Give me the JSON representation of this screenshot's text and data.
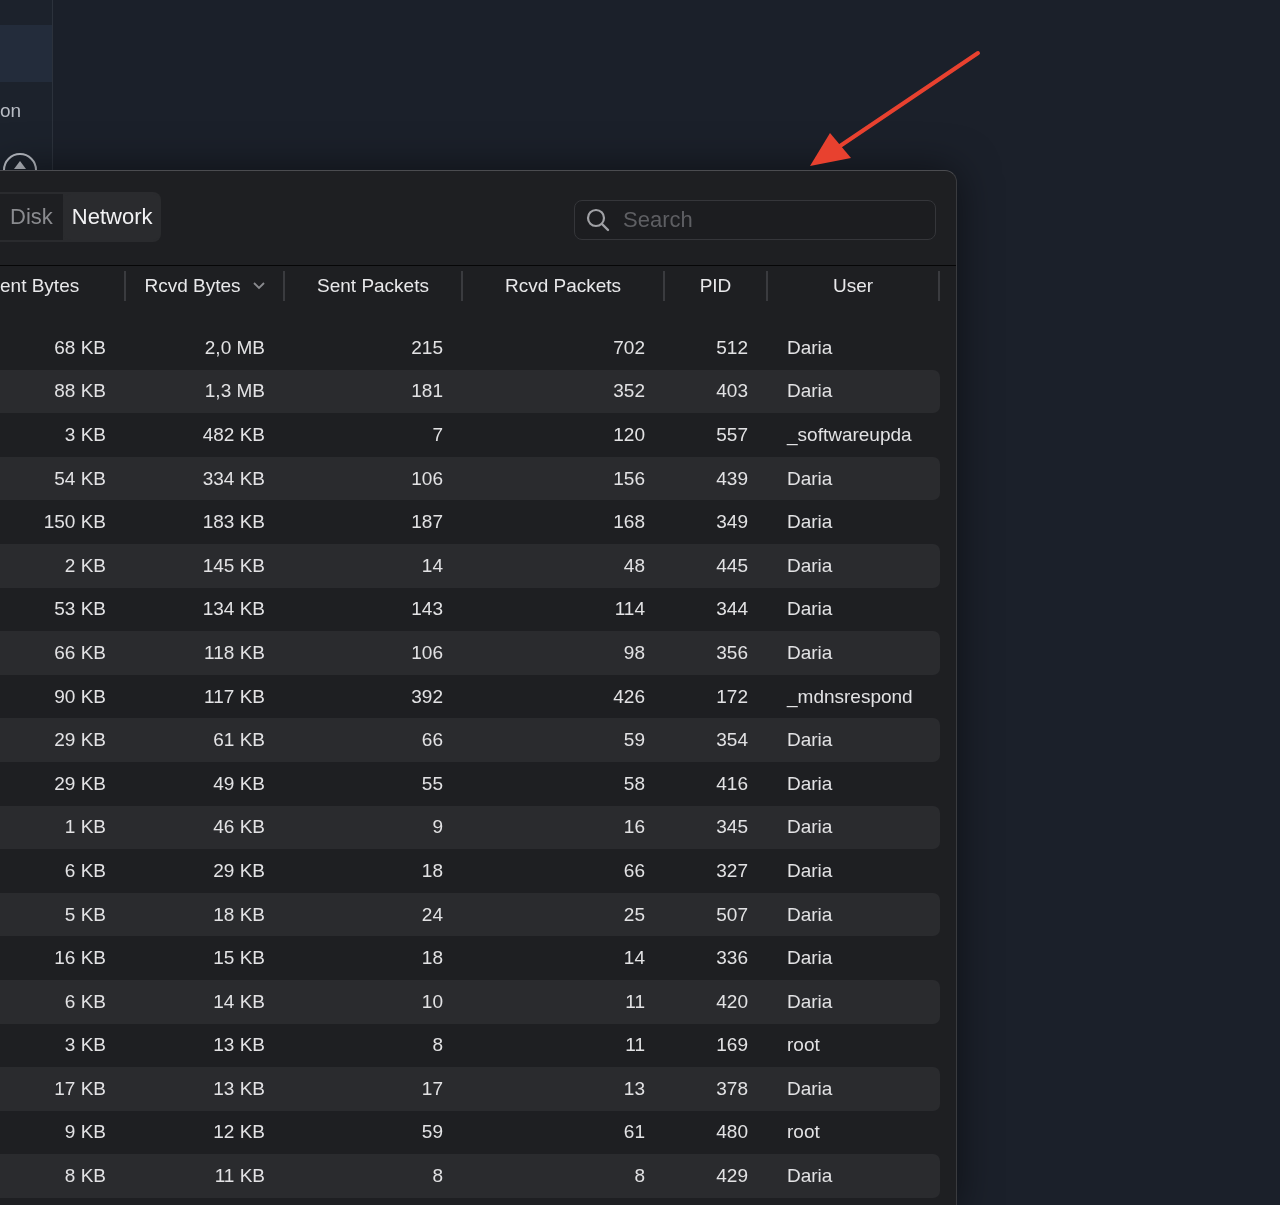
{
  "sidebar": {
    "items": [
      {
        "selected": true
      },
      {
        "label": "on",
        "selected": false
      }
    ]
  },
  "window": {
    "tabs": [
      {
        "label": "Disk",
        "selected": false
      },
      {
        "label": "Network",
        "selected": true
      }
    ],
    "search": {
      "placeholder": "Search"
    },
    "table": {
      "columns": [
        {
          "label": "ent Bytes",
          "sorted": false
        },
        {
          "label": "Rcvd Bytes",
          "sorted": true
        },
        {
          "label": "Sent Packets",
          "sorted": false
        },
        {
          "label": "Rcvd Packets",
          "sorted": false
        },
        {
          "label": "PID",
          "sorted": false
        },
        {
          "label": "User",
          "sorted": false
        }
      ],
      "rows": [
        [
          "68 KB",
          "2,0 MB",
          "215",
          "702",
          "512",
          "Daria"
        ],
        [
          "88 KB",
          "1,3 MB",
          "181",
          "352",
          "403",
          "Daria"
        ],
        [
          "3 KB",
          "482 KB",
          "7",
          "120",
          "557",
          "_softwareupda"
        ],
        [
          "54 KB",
          "334 KB",
          "106",
          "156",
          "439",
          "Daria"
        ],
        [
          "150 KB",
          "183 KB",
          "187",
          "168",
          "349",
          "Daria"
        ],
        [
          "2 KB",
          "145 KB",
          "14",
          "48",
          "445",
          "Daria"
        ],
        [
          "53 KB",
          "134 KB",
          "143",
          "114",
          "344",
          "Daria"
        ],
        [
          "66 KB",
          "118 KB",
          "106",
          "98",
          "356",
          "Daria"
        ],
        [
          "90 KB",
          "117 KB",
          "392",
          "426",
          "172",
          "_mdnsrespond"
        ],
        [
          "29 KB",
          "61 KB",
          "66",
          "59",
          "354",
          "Daria"
        ],
        [
          "29 KB",
          "49 KB",
          "55",
          "58",
          "416",
          "Daria"
        ],
        [
          "1 KB",
          "46 KB",
          "9",
          "16",
          "345",
          "Daria"
        ],
        [
          "6 KB",
          "29 KB",
          "18",
          "66",
          "327",
          "Daria"
        ],
        [
          "5 KB",
          "18 KB",
          "24",
          "25",
          "507",
          "Daria"
        ],
        [
          "16 KB",
          "15 KB",
          "18",
          "14",
          "336",
          "Daria"
        ],
        [
          "6 KB",
          "14 KB",
          "10",
          "11",
          "420",
          "Daria"
        ],
        [
          "3 KB",
          "13 KB",
          "8",
          "11",
          "169",
          "root"
        ],
        [
          "17 KB",
          "13 KB",
          "17",
          "13",
          "378",
          "Daria"
        ],
        [
          "9 KB",
          "12 KB",
          "59",
          "61",
          "480",
          "root"
        ],
        [
          "8 KB",
          "11 KB",
          "8",
          "8",
          "429",
          "Daria"
        ]
      ]
    }
  }
}
